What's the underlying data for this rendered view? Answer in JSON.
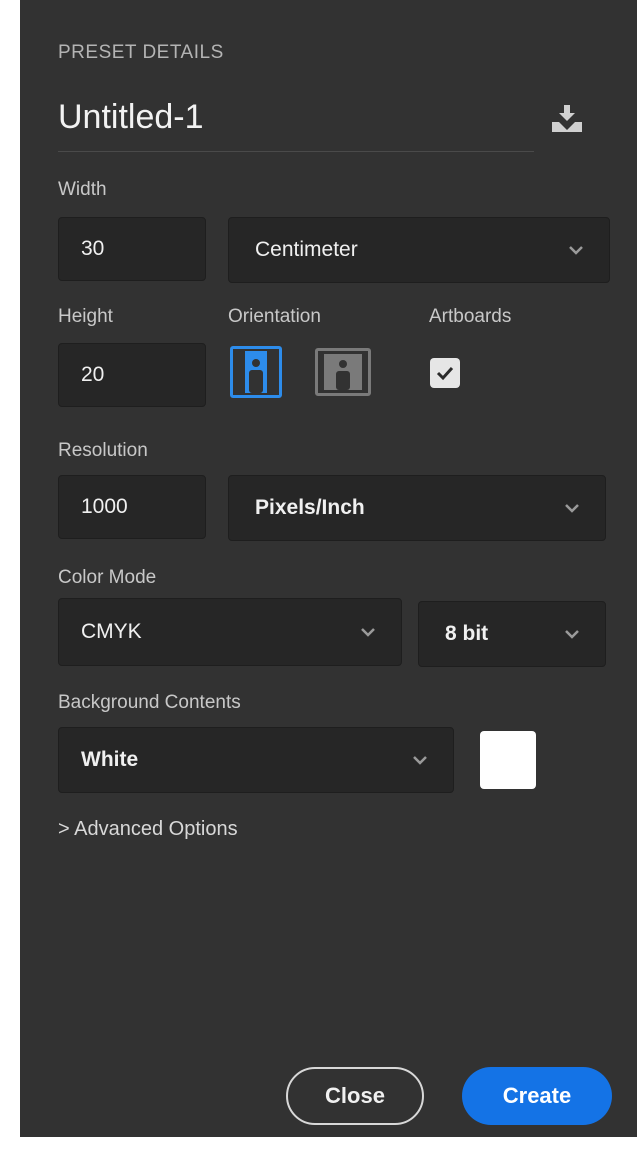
{
  "preset_details": {
    "section_title": "PRESET DETAILS",
    "document_name": "Untitled-1",
    "save_preset_icon": "save-preset-icon"
  },
  "width": {
    "label": "Width",
    "value": "30",
    "unit": "Centimeter"
  },
  "height": {
    "label": "Height",
    "value": "20"
  },
  "orientation": {
    "label": "Orientation",
    "selected": "portrait",
    "options": [
      "portrait",
      "landscape"
    ]
  },
  "artboards": {
    "label": "Artboards",
    "checked": true
  },
  "resolution": {
    "label": "Resolution",
    "value": "1000",
    "unit": "Pixels/Inch"
  },
  "color_mode": {
    "label": "Color Mode",
    "mode": "CMYK",
    "bit_depth": "8 bit"
  },
  "background_contents": {
    "label": "Background Contents",
    "value": "White",
    "swatch_color": "#ffffff"
  },
  "advanced": {
    "label": "> Advanced Options"
  },
  "buttons": {
    "close_label": "Close",
    "create_label": "Create"
  },
  "colors": {
    "accent": "#1473e6",
    "panel": "#323232",
    "field": "#262626"
  }
}
